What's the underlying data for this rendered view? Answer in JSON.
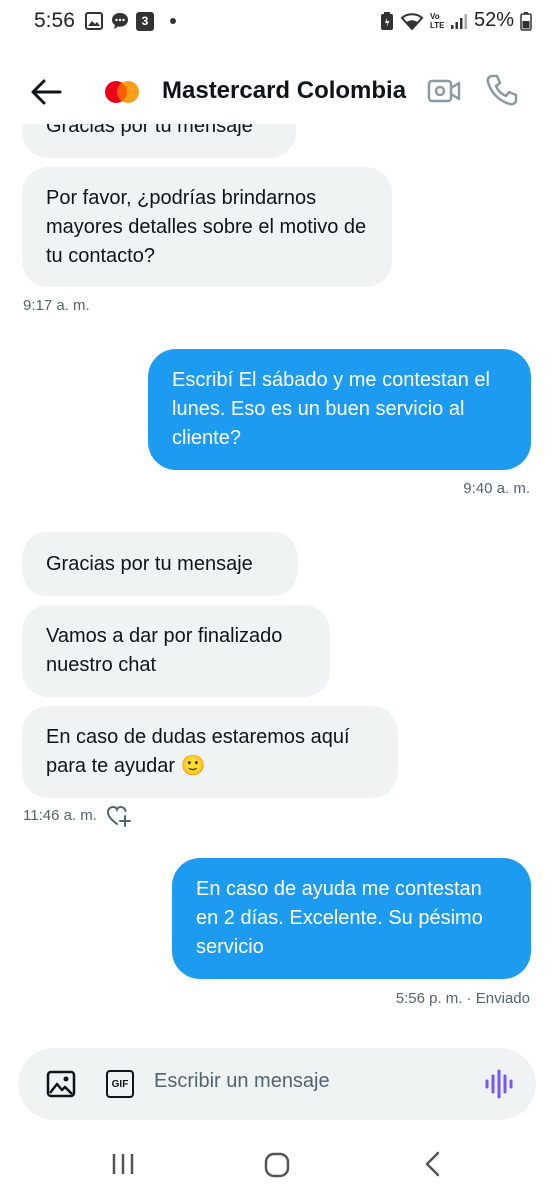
{
  "status_bar": {
    "time": "5:56",
    "notification_badge": "3",
    "network_label": "Vo LTE",
    "battery": "52%"
  },
  "header": {
    "title": "Mastercard Colombia",
    "logo_colors": [
      "#eb001b",
      "#f79e1b"
    ]
  },
  "messages": [
    {
      "side": "in",
      "text": "Gracias por tu mensaje"
    },
    {
      "side": "in",
      "text": "Por favor, ¿podrías brindarnos mayores detalles sobre el motivo de tu contacto?",
      "timestamp": "9:17 a. m."
    },
    {
      "side": "out",
      "text": "Escribí El sábado y me contestan el lunes. Eso es un buen servicio al cliente?",
      "timestamp": "9:40 a. m."
    },
    {
      "side": "in",
      "text": "Gracias por tu mensaje"
    },
    {
      "side": "in",
      "text": "Vamos a dar por finalizado nuestro chat"
    },
    {
      "side": "in",
      "text": "En caso de dudas estaremos aquí para te ayudar 🙂",
      "timestamp": "11:46 a. m."
    },
    {
      "side": "out",
      "text": "En caso de ayuda me contestan en 2 días. Excelente. Su pésimo servicio",
      "timestamp": "5:56 p. m. · Enviado"
    }
  ],
  "composer": {
    "placeholder": "Escribir un mensaje",
    "gif_label": "GIF"
  },
  "colors": {
    "outgoing_bubble": "#1d9bf0",
    "incoming_bubble": "#eff3f4",
    "voice_icon": "#7856ff"
  }
}
